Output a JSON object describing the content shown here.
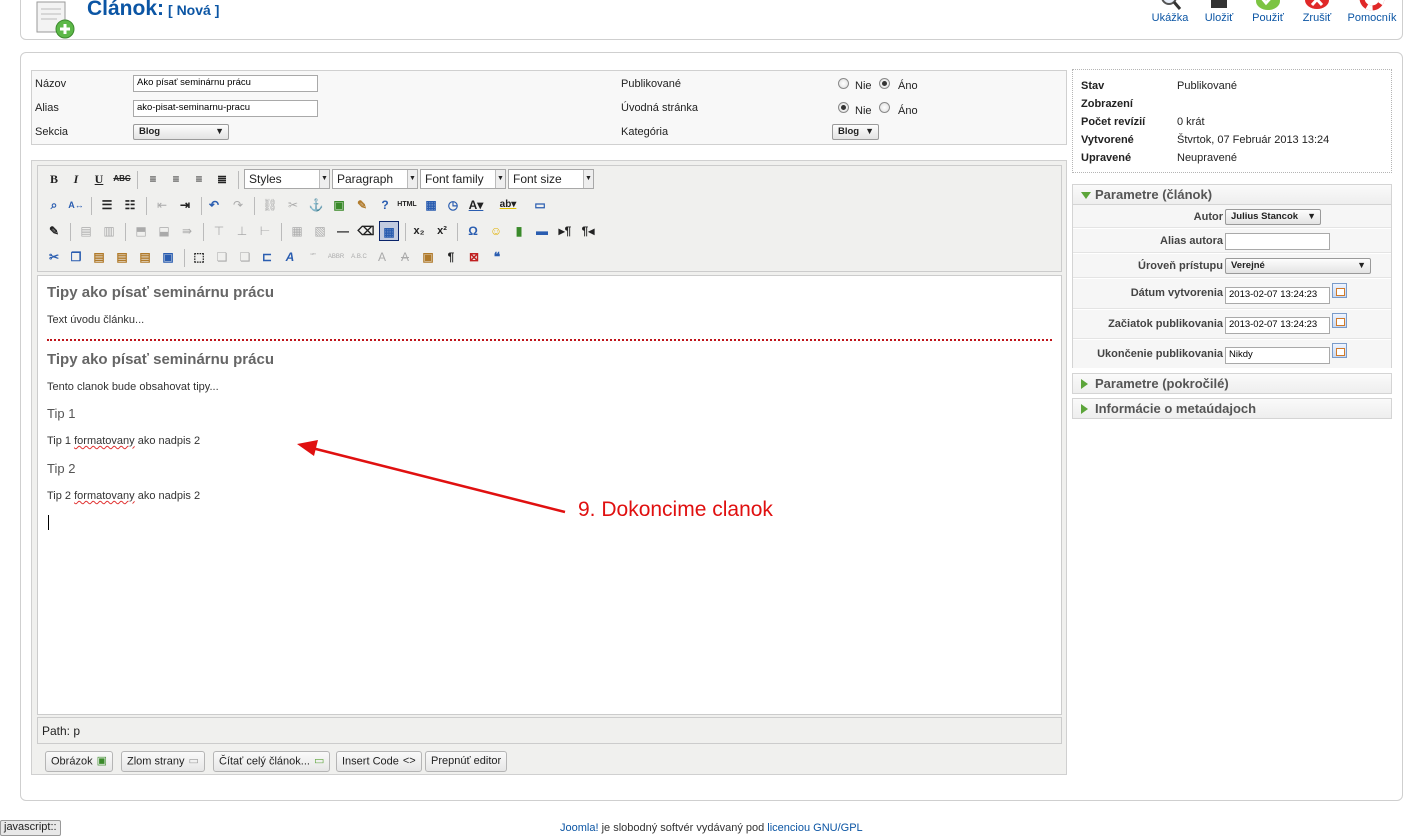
{
  "header": {
    "title": "Článok:",
    "subtitle": "[ Nová ]",
    "buttons": [
      "Ukážka",
      "Uložiť",
      "Použiť",
      "Zrušiť",
      "Pomocník"
    ]
  },
  "details": {
    "name_label": "Názov",
    "name_value": "Ako písať seminárnu prácu",
    "alias_label": "Alias",
    "alias_value": "ako-pisat-seminarnu-pracu",
    "section_label": "Sekcia",
    "section_value": "Blog",
    "published_label": "Publikované",
    "frontpage_label": "Úvodná stránka",
    "category_label": "Kategória",
    "category_value": "Blog",
    "no_label": "Nie",
    "yes_label": "Áno"
  },
  "editor": {
    "styles": "Styles",
    "paragraph": "Paragraph",
    "font_family": "Font family",
    "font_size": "Font size",
    "content": {
      "h1": "Tipy ako písať seminárnu prácu",
      "intro": "Text úvodu článku...",
      "h2": "Tipy ako písať seminárnu prácu",
      "body": "Tento clanok bude obsahovat tipy...",
      "tip1_title": "Tip 1",
      "tip1_pre": "Tip 1 ",
      "tip1_word": "formatovany",
      "tip1_post": " ako nadpis 2",
      "tip2_title": "Tip 2",
      "tip2_pre": "Tip 2 ",
      "tip2_word": "formatovany",
      "tip2_post": " ako nadpis 2"
    },
    "path": "Path: p",
    "buttons": [
      "Obrázok",
      "Zlom strany",
      "Čítať celý článok...",
      "Insert Code",
      "Prepnúť editor"
    ]
  },
  "status": {
    "rows": [
      {
        "k": "Stav",
        "v": "Publikované"
      },
      {
        "k": "Zobrazení",
        "v": ""
      },
      {
        "k": "Počet revízií",
        "v": "0 krát"
      },
      {
        "k": "Vytvorené",
        "v": "Štvrtok, 07 Február 2013 13:24"
      },
      {
        "k": "Upravené",
        "v": "Neupravené"
      }
    ]
  },
  "params": {
    "title": "Parametre (článok)",
    "author_label": "Autor",
    "author_value": "Julius Stancok",
    "alias_author_label": "Alias autora",
    "access_label": "Úroveň prístupu",
    "access_value": "Verejné",
    "created_label": "Dátum vytvorenia",
    "created_value": "2013-02-07 13:24:23",
    "pub_start_label": "Začiatok publikovania",
    "pub_start_value": "2013-02-07 13:24:23",
    "pub_end_label": "Ukončenie publikovania",
    "pub_end_value": "Nikdy"
  },
  "panes": {
    "advanced": "Parametre (pokročilé)",
    "metadata": "Informácie o metaúdajoch"
  },
  "annotation": "9. Dokoncime clanok",
  "footer": {
    "js": "javascript::",
    "link1": "Joomla!",
    "text": " je slobodný softvér vydávaný pod ",
    "link2": "licenciou GNU/GPL"
  },
  "colors": {
    "accent": "#0b55a4",
    "annotation": "#e01010",
    "readmore": "#c0151b"
  }
}
